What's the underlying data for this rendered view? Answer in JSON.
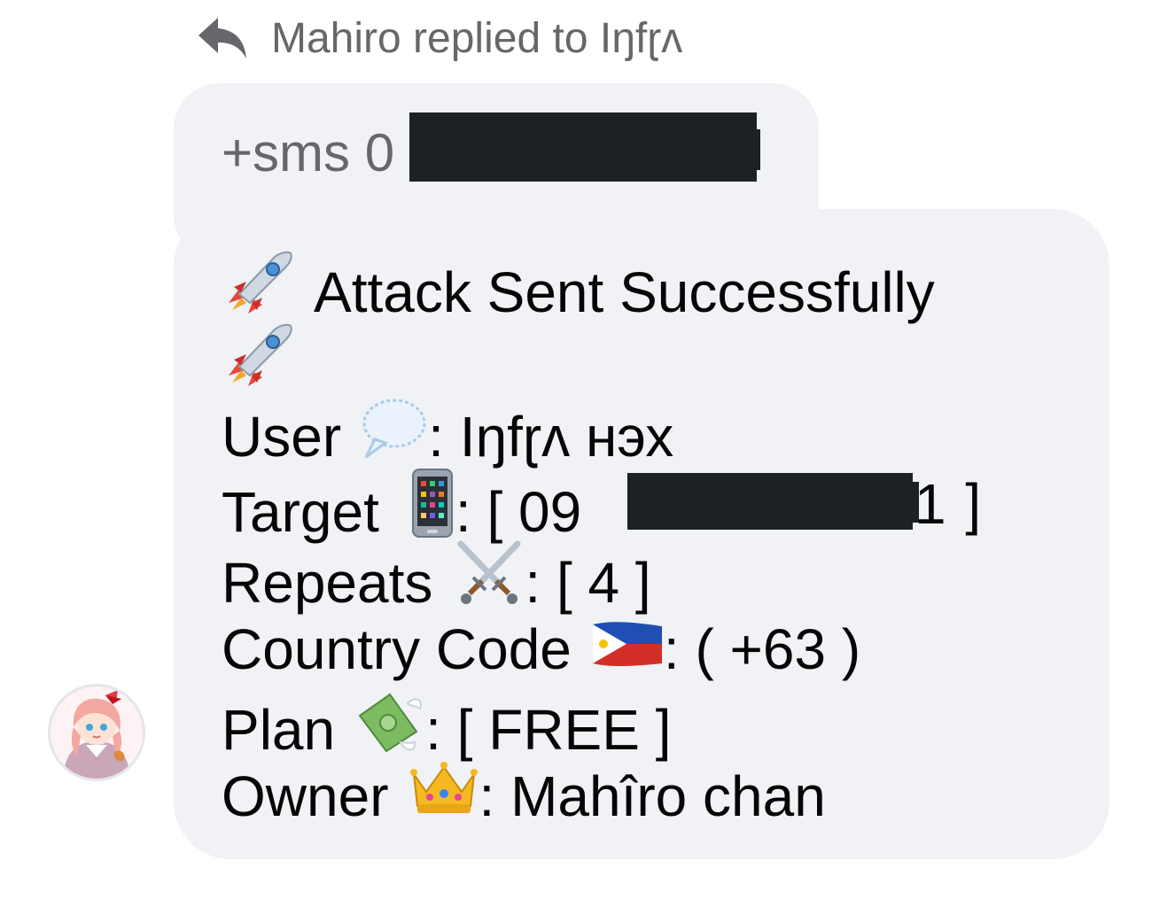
{
  "reply_header": {
    "text": "Mahiro replied to Iŋfɽʌ",
    "icon": "reply-arrow-icon"
  },
  "quoted_message": {
    "text": "+sms 0",
    "redacted": true
  },
  "message": {
    "title": "Attack Sent Successfully",
    "title_icon": "rocket-icon",
    "user_label": "User",
    "user_icon": "speech-balloon-icon",
    "user_value": ": Iŋfɽʌ нэх",
    "target_label": "Target",
    "target_icon": "mobile-phone-icon",
    "target_value": ": [ 09",
    "target_close": "1 ]",
    "repeats_label": "Repeats",
    "repeats_icon": "crossed-swords-icon",
    "repeats_value": ": [ 4 ]",
    "country_label": "Country Code",
    "country_icon": "philippines-flag-icon",
    "country_value": ": ( +63 )",
    "plan_label": "Plan",
    "plan_icon": "money-with-wings-icon",
    "plan_value": ": [ FREE ]",
    "owner_label": "Owner",
    "owner_icon": "crown-icon",
    "owner_value": ": Mahîro chan"
  },
  "avatar": {
    "icon": "anime-avatar-icon"
  }
}
